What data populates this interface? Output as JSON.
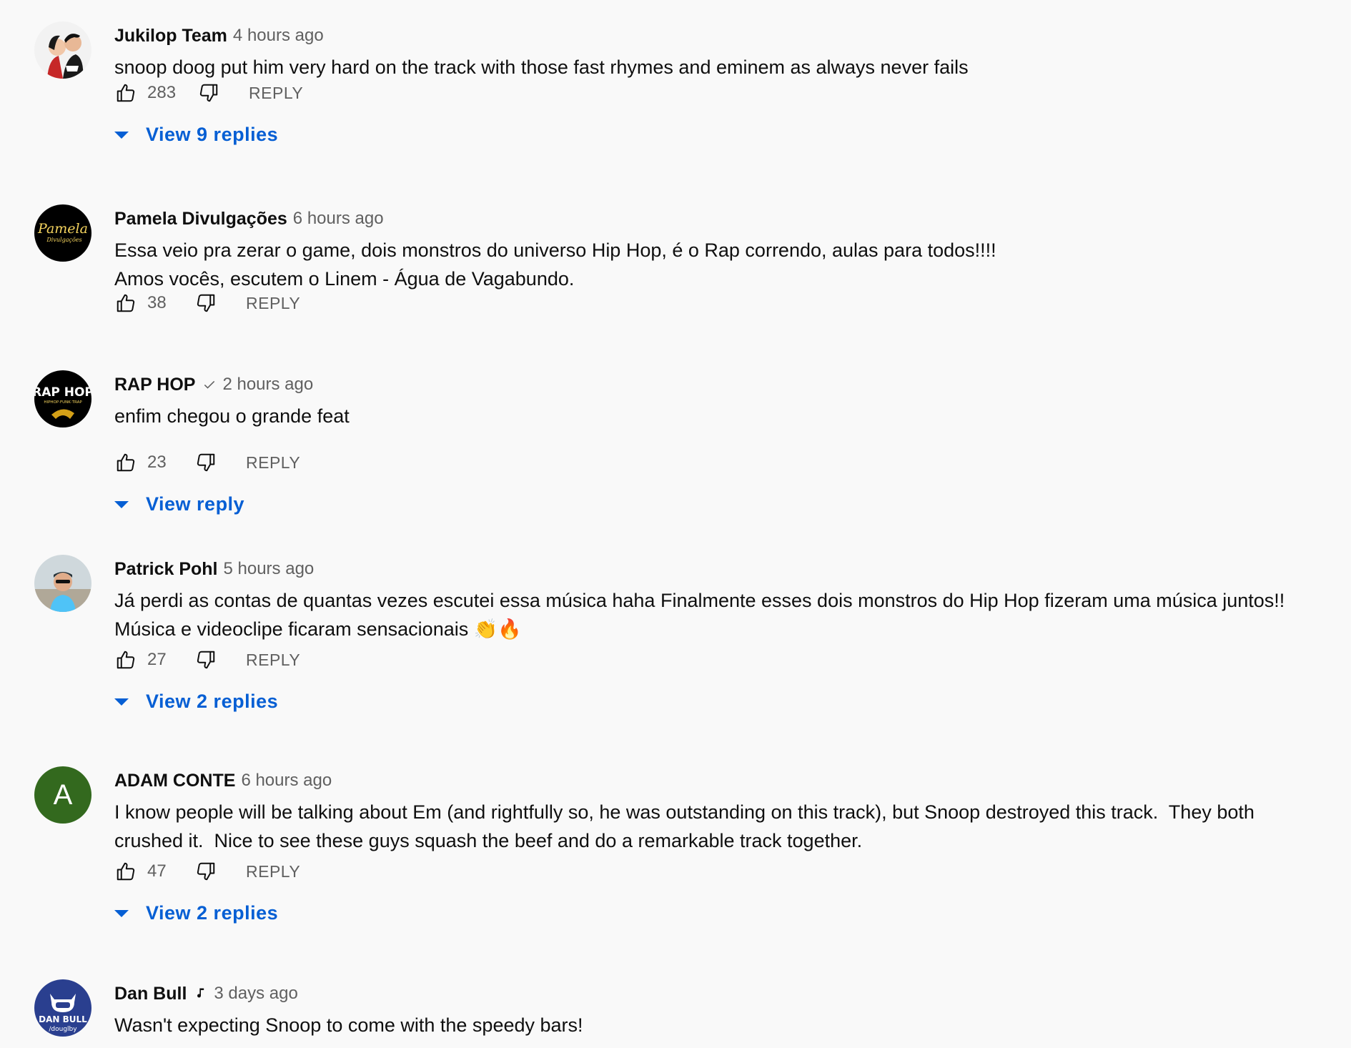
{
  "comments": [
    {
      "author": "Jukilop Team",
      "time": "4 hours ago",
      "lines": [
        "snoop doog put him very hard on the track with those fast rhymes and eminem as always never fails"
      ],
      "likes": "283",
      "reply_label": "REPLY",
      "view_replies": "View 9 replies",
      "avatar_icon": "couple-illustration-avatar"
    },
    {
      "author": "Pamela Divulgações",
      "time": "6 hours ago",
      "lines": [
        "Essa veio pra zerar o game, dois monstros do universo Hip Hop, é o Rap correndo, aulas para todos!!!!",
        "Amos vocês, escutem o Linem - Água de Vagabundo."
      ],
      "likes": "38",
      "reply_label": "REPLY",
      "avatar_text": "Pamela",
      "avatar_subtext": "Divulgações",
      "avatar_bg": "#000000"
    },
    {
      "author": "RAP HOP",
      "time": "2 hours ago",
      "verified_icon": "checkmark-icon",
      "lines": [
        "enfim chegou o grande feat"
      ],
      "likes": "23",
      "reply_label": "REPLY",
      "view_replies": "View reply",
      "avatar_text": "RAP HOP",
      "avatar_subtext": "HIPHOP·FUNK·TRAP",
      "avatar_bg": "#000000"
    },
    {
      "author": "Patrick Pohl",
      "time": "5 hours ago",
      "lines": [
        "Já perdi as contas de quantas vezes escutei essa música haha Finalmente esses dois monstros do Hip Hop fizeram uma música juntos!!",
        "Música e videoclipe ficaram sensacionais 👏🔥"
      ],
      "likes": "27",
      "reply_label": "REPLY",
      "view_replies": "View 2 replies",
      "avatar_icon": "person-photo-avatar"
    },
    {
      "author": "ADAM CONTE",
      "time": "6 hours ago",
      "lines": [
        "I know people will be talking about Em (and rightfully so, he was outstanding on this track), but Snoop destroyed this track.  They both",
        "crushed it.  Nice to see these guys squash the beef and do a remarkable track together."
      ],
      "likes": "47",
      "reply_label": "REPLY",
      "view_replies": "View 2 replies",
      "avatar_letter": "A",
      "avatar_bg": "#33691e"
    },
    {
      "author": "Dan Bull",
      "time": "3 days ago",
      "artist_icon": "music-note-icon",
      "lines": [
        "Wasn't expecting Snoop to come with the speedy bars!"
      ],
      "avatar_text": "DAN BULL",
      "avatar_subtext": "/douglby",
      "avatar_bg": "#2a3f8f"
    }
  ],
  "colors": {
    "background": "#f9f9f9",
    "link_blue": "#065fd4",
    "secondary_text": "#606060"
  }
}
